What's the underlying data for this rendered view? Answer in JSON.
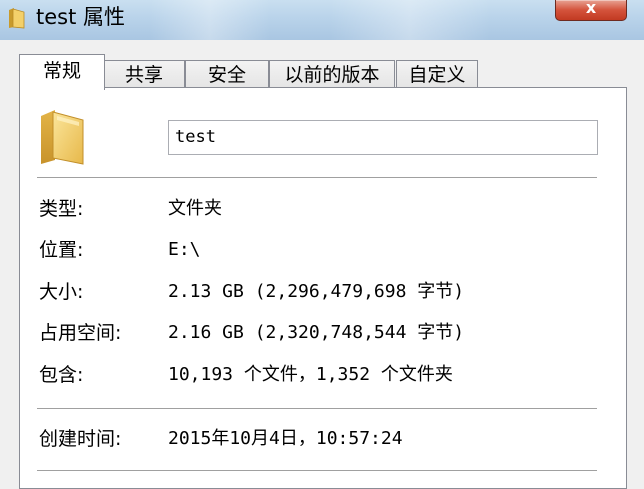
{
  "window": {
    "title": "test 属性",
    "close_symbol": "x"
  },
  "tabs": [
    {
      "label": "常规",
      "active": true
    },
    {
      "label": "共享",
      "active": false
    },
    {
      "label": "安全",
      "active": false
    },
    {
      "label": "以前的版本",
      "active": false
    },
    {
      "label": "自定义",
      "active": false
    }
  ],
  "general": {
    "folder_icon": "folder-icon",
    "name_value": "test",
    "rows": [
      {
        "label": "类型:",
        "value": "文件夹"
      },
      {
        "label": "位置:",
        "value": "E:\\"
      },
      {
        "label": "大小:",
        "value": "2.13 GB (2,296,479,698 字节)"
      },
      {
        "label": "占用空间:",
        "value": "2.16 GB (2,320,748,544 字节)"
      },
      {
        "label": "包含:",
        "value": "10,193 个文件，1,352 个文件夹"
      }
    ],
    "created": {
      "label": "创建时间:",
      "value": "2015年10月4日，10:57:24"
    }
  },
  "colors": {
    "titlebar": "#b9d3ea",
    "close_button": "#c9402a",
    "panel_border": "#898c95",
    "background": "#f0f0f0"
  }
}
